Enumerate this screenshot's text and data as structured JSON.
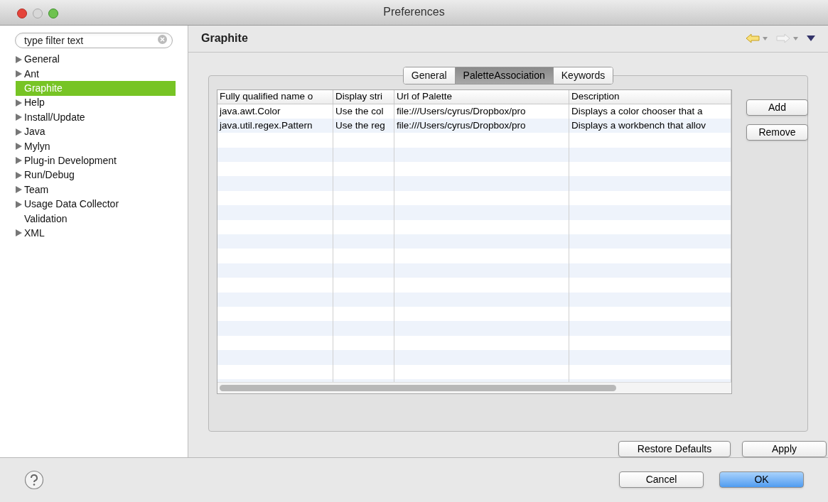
{
  "window": {
    "title": "Preferences"
  },
  "filter": {
    "placeholder": "type filter text"
  },
  "tree": [
    {
      "label": "General",
      "expandable": true,
      "selected": false
    },
    {
      "label": "Ant",
      "expandable": true,
      "selected": false
    },
    {
      "label": "Graphite",
      "expandable": false,
      "selected": true
    },
    {
      "label": "Help",
      "expandable": true,
      "selected": false
    },
    {
      "label": "Install/Update",
      "expandable": true,
      "selected": false
    },
    {
      "label": "Java",
      "expandable": true,
      "selected": false
    },
    {
      "label": "Mylyn",
      "expandable": true,
      "selected": false
    },
    {
      "label": "Plug-in Development",
      "expandable": true,
      "selected": false
    },
    {
      "label": "Run/Debug",
      "expandable": true,
      "selected": false
    },
    {
      "label": "Team",
      "expandable": true,
      "selected": false
    },
    {
      "label": "Usage Data Collector",
      "expandable": true,
      "selected": false
    },
    {
      "label": "Validation",
      "expandable": false,
      "selected": false
    },
    {
      "label": "XML",
      "expandable": true,
      "selected": false
    }
  ],
  "page": {
    "title": "Graphite"
  },
  "tabs": [
    {
      "label": "General",
      "selected": false
    },
    {
      "label": "PaletteAssociation",
      "selected": true
    },
    {
      "label": "Keywords",
      "selected": false
    }
  ],
  "table": {
    "columns": [
      "Fully qualified name o",
      "Display stri",
      "Url of Palette",
      "Description"
    ],
    "rows": [
      [
        "java.awt.Color",
        "Use the col",
        "file:///Users/cyrus/Dropbox/pro",
        "Displays a color chooser that a"
      ],
      [
        "java.util.regex.Pattern",
        "Use the reg",
        "file:///Users/cyrus/Dropbox/pro",
        "Displays a workbench that allov"
      ]
    ]
  },
  "side_buttons": [
    "Add",
    "Remove"
  ],
  "page_buttons": [
    "Restore Defaults",
    "Apply"
  ],
  "dialog_buttons": [
    {
      "label": "Cancel",
      "default": false
    },
    {
      "label": "OK",
      "default": true
    }
  ]
}
